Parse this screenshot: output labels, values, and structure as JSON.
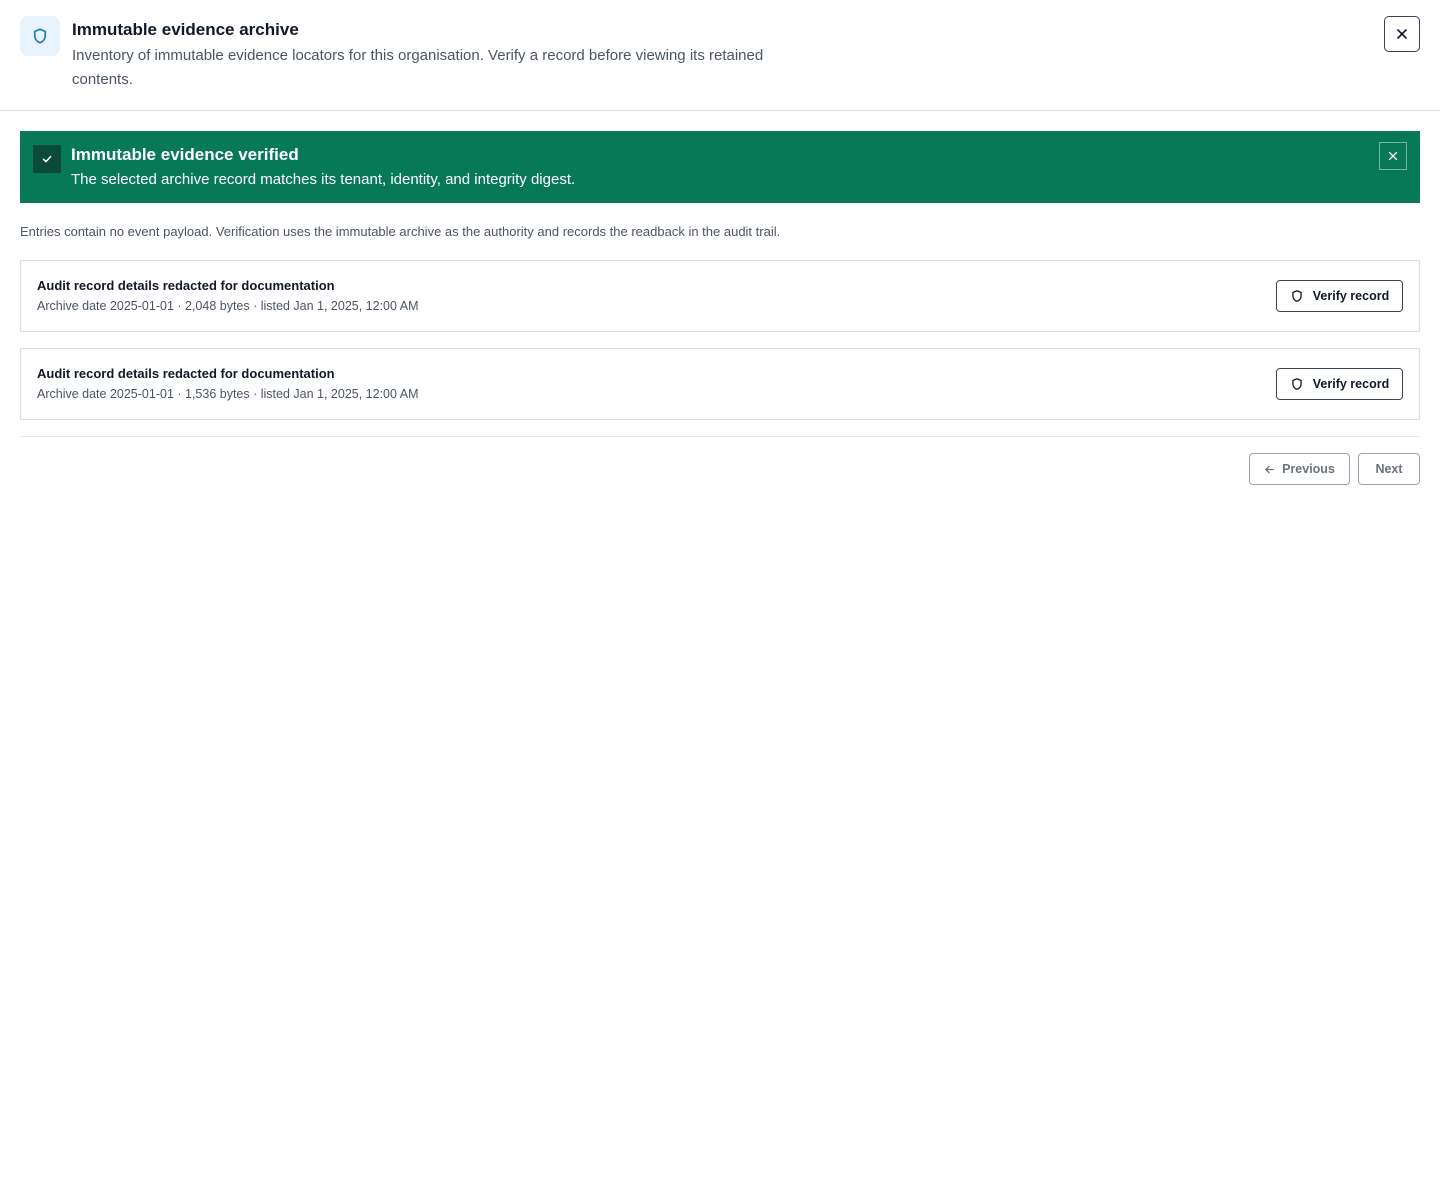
{
  "header": {
    "title": "Immutable evidence archive",
    "description": "Inventory of immutable evidence locators for this organisation. Verify a record before viewing its retained contents.",
    "icon": "shield-icon",
    "close_icon": "close-icon"
  },
  "banner": {
    "title": "Immutable evidence verified",
    "description": "The selected archive record matches its tenant, identity, and integrity digest.",
    "background": "#087956",
    "icon": "check-icon",
    "close_icon": "close-icon"
  },
  "note": "Entries contain no event payload. Verification uses the immutable archive as the authority and records the readback in the audit trail.",
  "records": [
    {
      "title": "Audit record details redacted for documentation",
      "meta": "Archive date 2025-01-01 · 2,048 bytes · listed Jan 1, 2025, 12:00 AM",
      "action_label": "Verify record"
    },
    {
      "title": "Audit record details redacted for documentation",
      "meta": "Archive date 2025-01-01 · 1,536 bytes · listed Jan 1, 2025, 12:00 AM",
      "action_label": "Verify record"
    }
  ],
  "pagination": {
    "previous_label": "Previous",
    "next_label": "Next",
    "previous_icon": "arrow-left-icon"
  }
}
